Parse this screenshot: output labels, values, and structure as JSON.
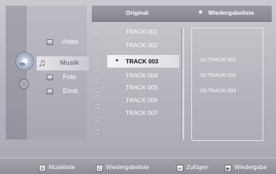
{
  "header": {
    "original": "Original",
    "star": "★",
    "playlist_title": "Wiedergabeliste"
  },
  "menu": {
    "cd_label": "CD",
    "items": [
      {
        "label": "Video",
        "icon": "video-icon"
      },
      {
        "label": "Musik",
        "icon": "music-note-icon",
        "selected": true
      },
      {
        "label": "Foto",
        "icon": "photo-icon"
      },
      {
        "label": "Einst.",
        "icon": "settings-icon"
      }
    ]
  },
  "tracks": [
    "TRACK 001",
    "TRACK 002",
    "TRACK 003",
    "TRACK 004",
    "TRACK 005",
    "TRACK 006",
    "TRACK 007"
  ],
  "selected_track_index": 2,
  "selected_marker": "•",
  "playlist": [
    "01.TRACK 001",
    "02.TRACK 002",
    "03.TRACK 003"
  ],
  "footer": {
    "b_key": "B",
    "b_label": "Musikliste",
    "c_key": "C",
    "c_label": "Wiedergabeliste",
    "add_label": "Zufügen",
    "play_label": "Wiedergabe"
  },
  "colors": {
    "background": "#b4b4bc",
    "text": "#ffffff",
    "selection": "#ececf0"
  }
}
